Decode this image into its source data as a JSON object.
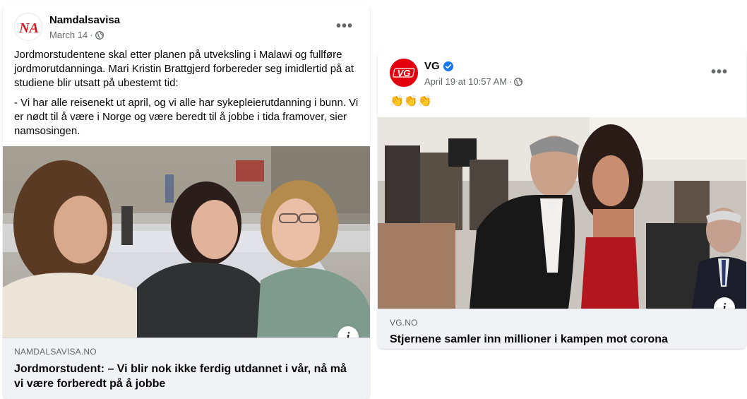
{
  "posts": [
    {
      "page_name": "Namdalsavisa",
      "avatar_text": "NA",
      "date": "March 14",
      "visibility_sep": "·",
      "privacy_icon": "globe-icon",
      "more_label": "•••",
      "paragraphs": [
        "Jordmorstudentene skal etter planen på utveksling i Malawi og fullføre jordmorutdanninga. Mari Kristin Brattgjerd forbereder seg imidlertid på at studiene blir utsatt på ubestemt tid:",
        "- Vi har alle reisenekt ut april, og vi alle har sykepleierutdanning i bunn. Vi er nødt til å være i Norge og være beredt til å jobbe i tida framover, sier namsosingen."
      ],
      "info_label": "i",
      "link_domain": "NAMDALSAVISA.NO",
      "link_title": "Jordmorstudent: – Vi blir nok ikke ferdig utdannet i vår, nå må vi være forberedt på å jobbe",
      "brand_color": "#d7161e"
    },
    {
      "page_name": "VG",
      "avatar_text": "VG",
      "verified_icon": "verified-badge-icon",
      "date": "April 19 at 10:57 AM",
      "visibility_sep": "·",
      "privacy_icon": "globe-icon",
      "more_label": "•••",
      "emoji_text": "👏👏👏",
      "info_label": "i",
      "link_domain": "VG.NO",
      "link_title": "Stjernene samler inn millioner i kampen mot corona",
      "brand_color": "#e3000f",
      "verified_color": "#1877f2"
    }
  ]
}
